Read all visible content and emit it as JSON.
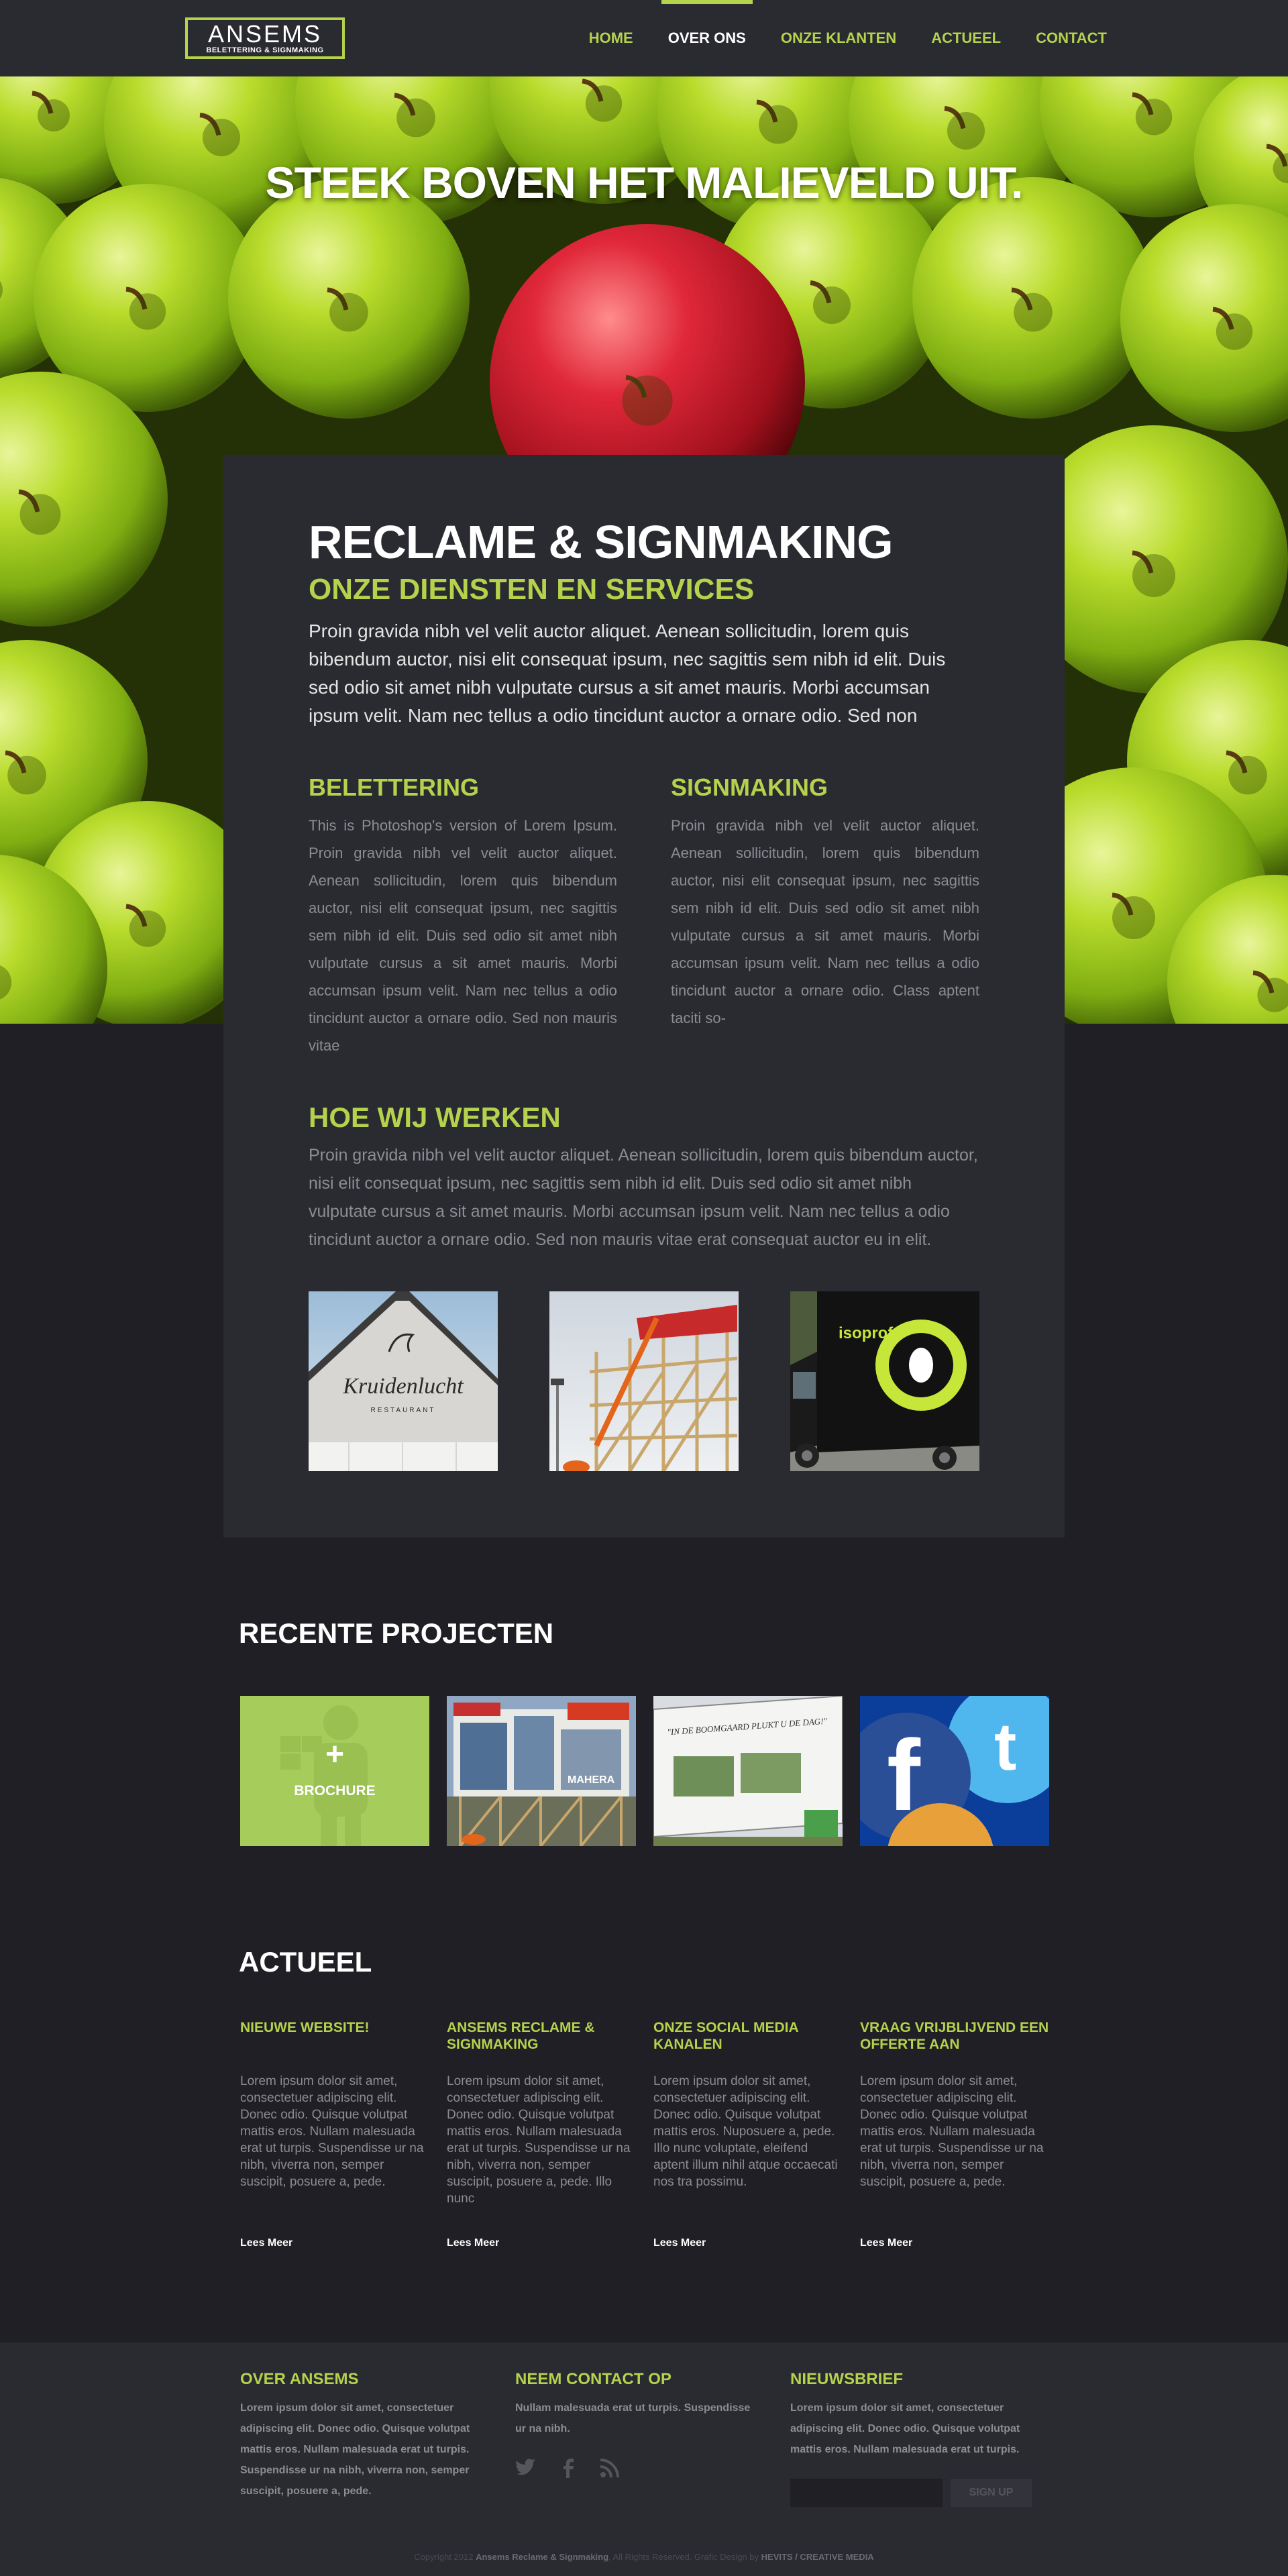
{
  "header": {
    "logo_main": "ANSEMS",
    "logo_sub": "BELETTERING & SIGNMAKING",
    "nav": [
      {
        "label": "HOME",
        "active": false
      },
      {
        "label": "OVER ONS",
        "active": true
      },
      {
        "label": "ONZE KLANTEN",
        "active": false
      },
      {
        "label": "ACTUEEL",
        "active": false
      },
      {
        "label": "CONTACT",
        "active": false
      }
    ]
  },
  "hero": {
    "title": "STEEK BOVEN HET MALIEVELD UIT."
  },
  "main": {
    "title": "RECLAME & SIGNMAKING",
    "subtitle": "ONZE DIENSTEN EN SERVICES",
    "intro": "Proin gravida nibh vel velit auctor aliquet. Aenean sollicitudin, lorem quis bibendum auctor, nisi elit consequat ipsum, nec sagittis sem nibh id elit. Duis sed odio sit amet nibh vulputate cursus a sit amet mauris. Morbi accumsan ipsum velit. Nam nec tellus a odio tincidunt auctor a ornare odio. Sed non",
    "col1_title": "BELETTERING",
    "col1_text": "This is Photoshop's version  of Lorem Ipsum. Proin gravida nibh vel velit auctor aliquet. Aenean sollicitudin, lorem quis bibendum auctor, nisi elit consequat ipsum, nec sagittis sem nibh id elit. Duis sed odio sit amet nibh vulputate cursus a sit amet mauris. Morbi accumsan ipsum velit. Nam nec tellus a odio tincidunt auctor a ornare odio. Sed non  mauris vitae",
    "col2_title": "SIGNMAKING",
    "col2_text": "Proin gravida nibh vel velit auctor aliquet. Aenean sollicitudin, lorem quis bibendum auctor, nisi elit consequat ipsum, nec sagittis sem nibh id elit. Duis sed odio sit amet nibh vulputate cursus a sit amet mauris. Morbi accumsan ipsum velit. Nam nec tellus a odio tincidunt auctor a ornare odio. Class aptent taciti so-",
    "how_title": "HOE WIJ WERKEN",
    "how_text": "Proin gravida nibh vel velit auctor aliquet. Aenean sollicitudin, lorem quis bibendum auctor, nisi elit consequat ipsum, nec sagittis sem nibh id elit. Duis sed odio sit amet nibh vulputate cursus a sit amet mauris. Morbi accumsan ipsum velit. Nam nec tellus a odio tincidunt auctor a ornare odio. Sed non  mauris vitae erat consequat auctor eu in elit.",
    "photo_texts": {
      "facade_sign": "Kruidenlucht",
      "facade_sub": "RESTAURANT",
      "van_brand": "isoprofs"
    }
  },
  "projects": {
    "title": "RECENTE PROJECTEN",
    "brochure_plus": "+",
    "brochure_label": "BROCHURE",
    "tile2_sign": "MAHERA",
    "tile3_sign": "\"IN DE BOOMGAARD PLUKT U DE DAG!\""
  },
  "news": {
    "title": "ACTUEEL",
    "more_label": "Lees Meer",
    "items": [
      {
        "title": "NIEUWE WEBSITE!",
        "text": "Lorem ipsum dolor sit amet, consectetuer adipiscing elit. Donec odio. Quisque volutpat mattis eros. Nullam malesuada erat ut turpis. Suspendisse ur na nibh, viverra non, semper suscipit, posuere a, pede."
      },
      {
        "title": "ANSEMS RECLAME & SIGNMAKING",
        "text": "Lorem ipsum dolor sit amet, consectetuer adipiscing elit. Donec odio. Quisque volutpat mattis eros. Nullam malesuada erat ut turpis. Suspendisse ur na nibh, viverra non, semper suscipit, posuere a, pede. Illo nunc"
      },
      {
        "title": "ONZE SOCIAL MEDIA KANALEN",
        "text": "Lorem ipsum dolor sit amet, consectetuer adipiscing elit. Donec odio. Quisque volutpat mattis eros. Nuposuere a, pede. Illo nunc voluptate, eleifend aptent illum nihil atque occaecati nos tra possimu."
      },
      {
        "title": "VRAAG VRIJBLIJVEND EEN OFFERTE AAN",
        "text": "Lorem ipsum dolor sit amet, consectetuer adipiscing elit. Donec odio. Quisque volutpat mattis eros. Nullam malesuada erat ut turpis. Suspendisse ur na nibh, viverra non, semper suscipit, posuere a, pede."
      }
    ]
  },
  "footer": {
    "about_title": "OVER ANSEMS",
    "about_text": "Lorem ipsum dolor sit amet, consectetuer adipiscing elit. Donec odio. Quisque volutpat mattis eros. Nullam malesuada erat ut turpis. Suspendisse ur na nibh, viverra non, semper suscipit, posuere a, pede.",
    "contact_title": "NEEM CONTACT OP",
    "contact_text": " Nullam malesuada erat ut turpis. Suspendisse ur na nibh.",
    "social_icons": [
      "twitter-icon",
      "facebook-icon",
      "rss-icon"
    ],
    "newsletter_title": "NIEUWSBRIEF",
    "newsletter_text": "Lorem ipsum dolor sit amet, consectetuer adipiscing elit. Donec odio. Quisque volutpat mattis eros. Nullam malesuada erat ut turpis.",
    "newsletter_placeholder": "",
    "newsletter_button": "SIGN UP",
    "copyright_pre": "Copyright 2012 ",
    "copyright_company": "Ansems Reclame & Signmaking",
    "copyright_mid": ", All Rights Reserved. Grafic Design by ",
    "copyright_credit": "HEVITS / CREATIVE MEDIA"
  },
  "colors": {
    "accent": "#b5d24d",
    "background": "#1f1f25",
    "panel": "#2a2a31"
  }
}
